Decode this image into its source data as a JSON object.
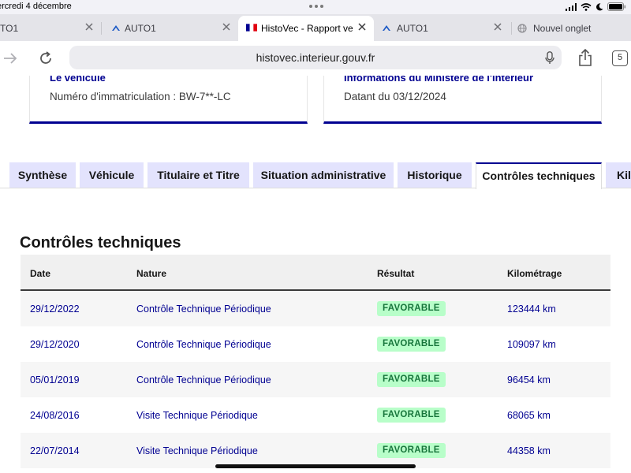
{
  "status_bar": {
    "date": "ercredi 4 décembre"
  },
  "browser": {
    "tabs": [
      {
        "title": "TO1",
        "favicon": "auto1-icon",
        "active": false
      },
      {
        "title": "AUTO1",
        "favicon": "auto1-icon",
        "active": false
      },
      {
        "title": "HistoVec - Rapport ve",
        "favicon": "french-flag-icon",
        "active": true
      },
      {
        "title": "AUTO1",
        "favicon": "auto1-icon",
        "active": false
      },
      {
        "title": "Nouvel onglet",
        "favicon": "globe-icon",
        "active": false
      }
    ],
    "url": "histovec.interieur.gouv.fr",
    "tab_count": "5"
  },
  "cards": {
    "vehicle": {
      "title": "Le véhicule",
      "text": "Numéro d'immatriculation : BW-7**-LC"
    },
    "ministry": {
      "title": "Informations du Ministère de l'Intérieur",
      "text": "Datant du 03/12/2024"
    }
  },
  "page_tabs": [
    {
      "label": "Synthèse",
      "active": false
    },
    {
      "label": "Véhicule",
      "active": false
    },
    {
      "label": "Titulaire et Titre",
      "active": false
    },
    {
      "label": "Situation administrative",
      "active": false
    },
    {
      "label": "Historique",
      "active": false
    },
    {
      "label": "Contrôles techniques",
      "active": true
    },
    {
      "label": "Kilo",
      "active": false
    }
  ],
  "section": {
    "title": "Contrôles techniques",
    "columns": {
      "date": "Date",
      "nature": "Nature",
      "result": "Résultat",
      "km": "Kilométrage"
    },
    "rows": [
      {
        "date": "29/12/2022",
        "nature": "Contrôle Technique Périodique",
        "result": "FAVORABLE",
        "km": "123444 km"
      },
      {
        "date": "29/12/2020",
        "nature": "Contrôle Technique Périodique",
        "result": "FAVORABLE",
        "km": "109097 km"
      },
      {
        "date": "05/01/2019",
        "nature": "Contrôle Technique Périodique",
        "result": "FAVORABLE",
        "km": "96454 km"
      },
      {
        "date": "24/08/2016",
        "nature": "Visite Technique Périodique",
        "result": "FAVORABLE",
        "km": "68065 km"
      },
      {
        "date": "22/07/2014",
        "nature": "Visite Technique Périodique",
        "result": "FAVORABLE",
        "km": "44358 km"
      }
    ]
  },
  "colors": {
    "dsfr_blue": "#000091",
    "tab_inactive_bg": "#e3e3fd",
    "badge_bg": "#b8fec9",
    "badge_text": "#18753c"
  }
}
